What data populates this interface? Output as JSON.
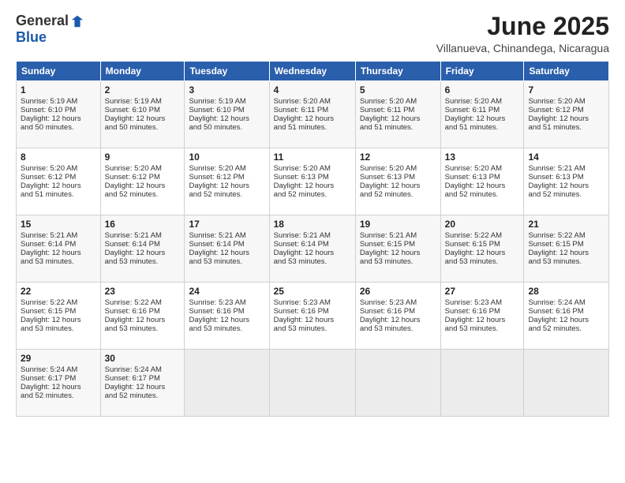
{
  "logo": {
    "general": "General",
    "blue": "Blue"
  },
  "title": "June 2025",
  "subtitle": "Villanueva, Chinandega, Nicaragua",
  "header": {
    "days": [
      "Sunday",
      "Monday",
      "Tuesday",
      "Wednesday",
      "Thursday",
      "Friday",
      "Saturday"
    ]
  },
  "weeks": [
    [
      {
        "day": "1",
        "lines": [
          "Sunrise: 5:19 AM",
          "Sunset: 6:10 PM",
          "Daylight: 12 hours",
          "and 50 minutes."
        ]
      },
      {
        "day": "2",
        "lines": [
          "Sunrise: 5:19 AM",
          "Sunset: 6:10 PM",
          "Daylight: 12 hours",
          "and 50 minutes."
        ]
      },
      {
        "day": "3",
        "lines": [
          "Sunrise: 5:19 AM",
          "Sunset: 6:10 PM",
          "Daylight: 12 hours",
          "and 50 minutes."
        ]
      },
      {
        "day": "4",
        "lines": [
          "Sunrise: 5:20 AM",
          "Sunset: 6:11 PM",
          "Daylight: 12 hours",
          "and 51 minutes."
        ]
      },
      {
        "day": "5",
        "lines": [
          "Sunrise: 5:20 AM",
          "Sunset: 6:11 PM",
          "Daylight: 12 hours",
          "and 51 minutes."
        ]
      },
      {
        "day": "6",
        "lines": [
          "Sunrise: 5:20 AM",
          "Sunset: 6:11 PM",
          "Daylight: 12 hours",
          "and 51 minutes."
        ]
      },
      {
        "day": "7",
        "lines": [
          "Sunrise: 5:20 AM",
          "Sunset: 6:12 PM",
          "Daylight: 12 hours",
          "and 51 minutes."
        ]
      }
    ],
    [
      {
        "day": "8",
        "lines": [
          "Sunrise: 5:20 AM",
          "Sunset: 6:12 PM",
          "Daylight: 12 hours",
          "and 51 minutes."
        ]
      },
      {
        "day": "9",
        "lines": [
          "Sunrise: 5:20 AM",
          "Sunset: 6:12 PM",
          "Daylight: 12 hours",
          "and 52 minutes."
        ]
      },
      {
        "day": "10",
        "lines": [
          "Sunrise: 5:20 AM",
          "Sunset: 6:12 PM",
          "Daylight: 12 hours",
          "and 52 minutes."
        ]
      },
      {
        "day": "11",
        "lines": [
          "Sunrise: 5:20 AM",
          "Sunset: 6:13 PM",
          "Daylight: 12 hours",
          "and 52 minutes."
        ]
      },
      {
        "day": "12",
        "lines": [
          "Sunrise: 5:20 AM",
          "Sunset: 6:13 PM",
          "Daylight: 12 hours",
          "and 52 minutes."
        ]
      },
      {
        "day": "13",
        "lines": [
          "Sunrise: 5:20 AM",
          "Sunset: 6:13 PM",
          "Daylight: 12 hours",
          "and 52 minutes."
        ]
      },
      {
        "day": "14",
        "lines": [
          "Sunrise: 5:21 AM",
          "Sunset: 6:13 PM",
          "Daylight: 12 hours",
          "and 52 minutes."
        ]
      }
    ],
    [
      {
        "day": "15",
        "lines": [
          "Sunrise: 5:21 AM",
          "Sunset: 6:14 PM",
          "Daylight: 12 hours",
          "and 53 minutes."
        ]
      },
      {
        "day": "16",
        "lines": [
          "Sunrise: 5:21 AM",
          "Sunset: 6:14 PM",
          "Daylight: 12 hours",
          "and 53 minutes."
        ]
      },
      {
        "day": "17",
        "lines": [
          "Sunrise: 5:21 AM",
          "Sunset: 6:14 PM",
          "Daylight: 12 hours",
          "and 53 minutes."
        ]
      },
      {
        "day": "18",
        "lines": [
          "Sunrise: 5:21 AM",
          "Sunset: 6:14 PM",
          "Daylight: 12 hours",
          "and 53 minutes."
        ]
      },
      {
        "day": "19",
        "lines": [
          "Sunrise: 5:21 AM",
          "Sunset: 6:15 PM",
          "Daylight: 12 hours",
          "and 53 minutes."
        ]
      },
      {
        "day": "20",
        "lines": [
          "Sunrise: 5:22 AM",
          "Sunset: 6:15 PM",
          "Daylight: 12 hours",
          "and 53 minutes."
        ]
      },
      {
        "day": "21",
        "lines": [
          "Sunrise: 5:22 AM",
          "Sunset: 6:15 PM",
          "Daylight: 12 hours",
          "and 53 minutes."
        ]
      }
    ],
    [
      {
        "day": "22",
        "lines": [
          "Sunrise: 5:22 AM",
          "Sunset: 6:15 PM",
          "Daylight: 12 hours",
          "and 53 minutes."
        ]
      },
      {
        "day": "23",
        "lines": [
          "Sunrise: 5:22 AM",
          "Sunset: 6:16 PM",
          "Daylight: 12 hours",
          "and 53 minutes."
        ]
      },
      {
        "day": "24",
        "lines": [
          "Sunrise: 5:23 AM",
          "Sunset: 6:16 PM",
          "Daylight: 12 hours",
          "and 53 minutes."
        ]
      },
      {
        "day": "25",
        "lines": [
          "Sunrise: 5:23 AM",
          "Sunset: 6:16 PM",
          "Daylight: 12 hours",
          "and 53 minutes."
        ]
      },
      {
        "day": "26",
        "lines": [
          "Sunrise: 5:23 AM",
          "Sunset: 6:16 PM",
          "Daylight: 12 hours",
          "and 53 minutes."
        ]
      },
      {
        "day": "27",
        "lines": [
          "Sunrise: 5:23 AM",
          "Sunset: 6:16 PM",
          "Daylight: 12 hours",
          "and 53 minutes."
        ]
      },
      {
        "day": "28",
        "lines": [
          "Sunrise: 5:24 AM",
          "Sunset: 6:16 PM",
          "Daylight: 12 hours",
          "and 52 minutes."
        ]
      }
    ],
    [
      {
        "day": "29",
        "lines": [
          "Sunrise: 5:24 AM",
          "Sunset: 6:17 PM",
          "Daylight: 12 hours",
          "and 52 minutes."
        ]
      },
      {
        "day": "30",
        "lines": [
          "Sunrise: 5:24 AM",
          "Sunset: 6:17 PM",
          "Daylight: 12 hours",
          "and 52 minutes."
        ]
      },
      {
        "day": "",
        "lines": []
      },
      {
        "day": "",
        "lines": []
      },
      {
        "day": "",
        "lines": []
      },
      {
        "day": "",
        "lines": []
      },
      {
        "day": "",
        "lines": []
      }
    ]
  ]
}
